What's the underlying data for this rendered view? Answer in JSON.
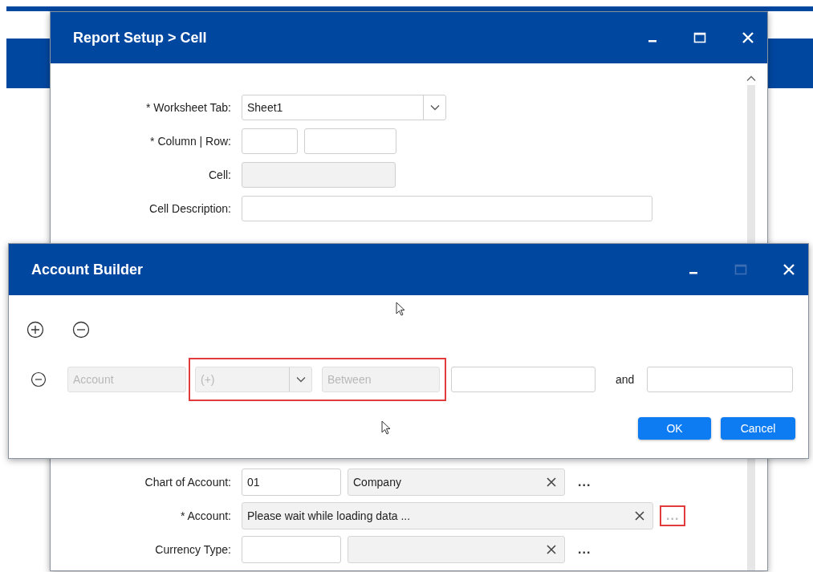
{
  "report_window": {
    "title": "Report Setup > Cell",
    "maximize_disabled": false,
    "form": [
      {
        "label": "* Worksheet Tab:",
        "kind": "select",
        "value": "Sheet1"
      },
      {
        "label": "* Column | Row:",
        "kind": "pair"
      },
      {
        "label": "Cell:",
        "kind": "readonly"
      },
      {
        "label": "Cell Description:",
        "kind": "text"
      }
    ],
    "lookups": [
      {
        "label": "Chart of Account:",
        "kind": "pair",
        "code": "01",
        "name": "Company",
        "more": "...",
        "more_disabled": false,
        "highlighted": false
      },
      {
        "label": "* Account:",
        "kind": "wide",
        "name": "Please wait while loading data ...",
        "more": "...",
        "more_disabled": true,
        "highlighted": true
      },
      {
        "label": "Currency Type:",
        "kind": "pair",
        "more": "...",
        "more_disabled": false,
        "highlighted": false
      }
    ]
  },
  "account_builder": {
    "title": "Account Builder",
    "maximize_disabled": true,
    "condition": {
      "field": "Account",
      "operator": "(+)",
      "comparison": "Between",
      "joiner": "and",
      "highlighted": true
    },
    "buttons": [
      "OK",
      "Cancel"
    ]
  }
}
